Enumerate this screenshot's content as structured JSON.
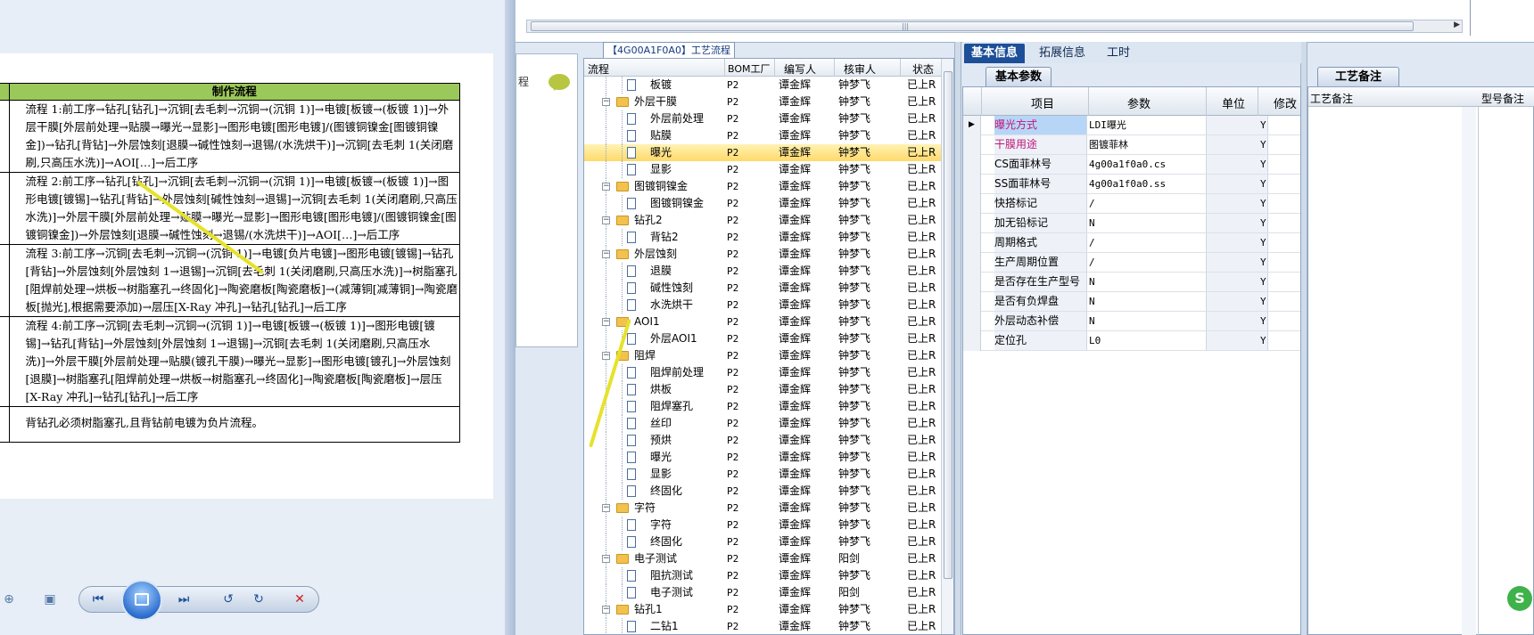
{
  "doc": {
    "table_header": "制作流程",
    "flows": [
      "流程 1:前工序→钻孔[钻孔]→沉铜[去毛刺→沉铜→(沉铜 1)]→电镀[板镀→(板镀 1)]→外层干膜[外层前处理→贴膜→曝光→显影]→图形电镀[图形电镀]/(图镀铜镍金[图镀铜镍金])→钻孔[背钻]→外层蚀刻[退膜→碱性蚀刻→退锡/(水洗烘干)]→沉铜[去毛刺 1(关闭磨刷,只高压水洗)]→AOI[…]→后工序",
      "流程 2:前工序→钻孔[钻孔]→沉铜[去毛刺→沉铜→(沉铜 1)]→电镀[板镀→(板镀 1)]→图形电镀[镀锡]→钻孔[背钻]→外层蚀刻[碱性蚀刻→退锡]→沉铜[去毛刺 1(关闭磨刷,只高压水洗)]→外层干膜[外层前处理→贴膜→曝光→显影]→图形电镀[图形电镀]/(图镀铜镍金[图镀铜镍金])→外层蚀刻[退膜→碱性蚀刻→退锡/(水洗烘干)]→AOI[…]→后工序",
      "流程 3:前工序→沉铜[去毛刺→沉铜→(沉铜 1)]→电镀[负片电镀]→图形电镀[镀锡]→钻孔[背钻]→外层蚀刻[外层蚀刻 1→退锡]→沉铜[去毛刺 1(关闭磨刷,只高压水洗)]→树脂塞孔[阻焊前处理→烘板→树脂塞孔→终固化]→陶瓷磨板[陶瓷磨板]→(减薄铜[减薄铜]→陶瓷磨板[抛光],根据需要添加)→层压[X-Ray 冲孔]→钻孔[钻孔]→后工序",
      "流程 4:前工序→沉铜[去毛刺→沉铜→(沉铜 1)]→电镀[板镀→(板镀 1)]→图形电镀[镀锡]→钻孔[背钻]→外层蚀刻[外层蚀刻 1→退锡]→沉铜[去毛刺 1(关闭磨刷,只高压水洗)]→外层干膜[外层前处理→贴膜(镀孔干膜)→曝光→显影]→图形电镀[镀孔]→外层蚀刻[退膜]→树脂塞孔[阻焊前处理→烘板→树脂塞孔→终固化]→陶瓷磨板[陶瓷磨板]→层压[X-Ray 冲孔]→钻孔[钻孔]→后工序"
    ],
    "note": "背钻孔必须树脂塞孔,且背钻前电镀为负片流程。"
  },
  "under_panel": {
    "label": "程"
  },
  "tree": {
    "tab_label": "【4G00A1F0A0】工艺流程",
    "columns": [
      "流程",
      "BOM工厂",
      "编写人",
      "核审人",
      "状态"
    ],
    "rows": [
      {
        "level": 2,
        "type": "doc",
        "name": "板镀",
        "bom": "P2",
        "writer": "谭金辉",
        "reviewer": "钟梦飞",
        "status": "已上R"
      },
      {
        "level": 1,
        "type": "folder",
        "name": "外层干膜",
        "bom": "P2",
        "writer": "谭金辉",
        "reviewer": "钟梦飞",
        "status": "已上R"
      },
      {
        "level": 2,
        "type": "doc",
        "name": "外层前处理",
        "bom": "P2",
        "writer": "谭金辉",
        "reviewer": "钟梦飞",
        "status": "已上R"
      },
      {
        "level": 2,
        "type": "doc",
        "name": "贴膜",
        "bom": "P2",
        "writer": "谭金辉",
        "reviewer": "钟梦飞",
        "status": "已上R"
      },
      {
        "level": 2,
        "type": "doc",
        "name": "曝光",
        "bom": "P2",
        "writer": "谭金辉",
        "reviewer": "钟梦飞",
        "status": "已上R",
        "selected": true
      },
      {
        "level": 2,
        "type": "doc",
        "name": "显影",
        "bom": "P2",
        "writer": "谭金辉",
        "reviewer": "钟梦飞",
        "status": "已上R"
      },
      {
        "level": 1,
        "type": "folder",
        "name": "图镀铜镍金",
        "bom": "P2",
        "writer": "谭金辉",
        "reviewer": "钟梦飞",
        "status": "已上R"
      },
      {
        "level": 2,
        "type": "doc",
        "name": "图镀铜镍金",
        "bom": "P2",
        "writer": "谭金辉",
        "reviewer": "钟梦飞",
        "status": "已上R"
      },
      {
        "level": 1,
        "type": "folder",
        "name": "钻孔2",
        "bom": "P2",
        "writer": "谭金辉",
        "reviewer": "钟梦飞",
        "status": "已上R"
      },
      {
        "level": 2,
        "type": "doc",
        "name": "背钻2",
        "bom": "P2",
        "writer": "谭金辉",
        "reviewer": "钟梦飞",
        "status": "已上R"
      },
      {
        "level": 1,
        "type": "folder",
        "name": "外层蚀刻",
        "bom": "P2",
        "writer": "谭金辉",
        "reviewer": "钟梦飞",
        "status": "已上R"
      },
      {
        "level": 2,
        "type": "doc",
        "name": "退膜",
        "bom": "P2",
        "writer": "谭金辉",
        "reviewer": "钟梦飞",
        "status": "已上R"
      },
      {
        "level": 2,
        "type": "doc",
        "name": "碱性蚀刻",
        "bom": "P2",
        "writer": "谭金辉",
        "reviewer": "钟梦飞",
        "status": "已上R"
      },
      {
        "level": 2,
        "type": "doc",
        "name": "水洗烘干",
        "bom": "P2",
        "writer": "谭金辉",
        "reviewer": "钟梦飞",
        "status": "已上R"
      },
      {
        "level": 1,
        "type": "folder",
        "name": "AOI1",
        "bom": "P2",
        "writer": "谭金辉",
        "reviewer": "钟梦飞",
        "status": "已上R"
      },
      {
        "level": 2,
        "type": "doc",
        "name": "外层AOI1",
        "bom": "P2",
        "writer": "谭金辉",
        "reviewer": "钟梦飞",
        "status": "已上R"
      },
      {
        "level": 1,
        "type": "folder",
        "name": "阻焊",
        "bom": "P2",
        "writer": "谭金辉",
        "reviewer": "钟梦飞",
        "status": "已上R"
      },
      {
        "level": 2,
        "type": "doc",
        "name": "阻焊前处理",
        "bom": "P2",
        "writer": "谭金辉",
        "reviewer": "钟梦飞",
        "status": "已上R"
      },
      {
        "level": 2,
        "type": "doc",
        "name": "烘板",
        "bom": "P2",
        "writer": "谭金辉",
        "reviewer": "钟梦飞",
        "status": "已上R"
      },
      {
        "level": 2,
        "type": "doc",
        "name": "阻焊塞孔",
        "bom": "P2",
        "writer": "谭金辉",
        "reviewer": "钟梦飞",
        "status": "已上R"
      },
      {
        "level": 2,
        "type": "doc",
        "name": "丝印",
        "bom": "P2",
        "writer": "谭金辉",
        "reviewer": "钟梦飞",
        "status": "已上R"
      },
      {
        "level": 2,
        "type": "doc",
        "name": "预烘",
        "bom": "P2",
        "writer": "谭金辉",
        "reviewer": "钟梦飞",
        "status": "已上R"
      },
      {
        "level": 2,
        "type": "doc",
        "name": "曝光",
        "bom": "P2",
        "writer": "谭金辉",
        "reviewer": "钟梦飞",
        "status": "已上R"
      },
      {
        "level": 2,
        "type": "doc",
        "name": "显影",
        "bom": "P2",
        "writer": "谭金辉",
        "reviewer": "钟梦飞",
        "status": "已上R"
      },
      {
        "level": 2,
        "type": "doc",
        "name": "终固化",
        "bom": "P2",
        "writer": "谭金辉",
        "reviewer": "钟梦飞",
        "status": "已上R"
      },
      {
        "level": 1,
        "type": "folder",
        "name": "字符",
        "bom": "P2",
        "writer": "谭金辉",
        "reviewer": "钟梦飞",
        "status": "已上R"
      },
      {
        "level": 2,
        "type": "doc",
        "name": "字符",
        "bom": "P2",
        "writer": "谭金辉",
        "reviewer": "钟梦飞",
        "status": "已上R"
      },
      {
        "level": 2,
        "type": "doc",
        "name": "终固化",
        "bom": "P2",
        "writer": "谭金辉",
        "reviewer": "钟梦飞",
        "status": "已上R"
      },
      {
        "level": 1,
        "type": "folder",
        "name": "电子测试",
        "bom": "P2",
        "writer": "谭金辉",
        "reviewer": "阳剑",
        "status": "已上R"
      },
      {
        "level": 2,
        "type": "doc",
        "name": "阻抗测试",
        "bom": "P2",
        "writer": "谭金辉",
        "reviewer": "钟梦飞",
        "status": "已上R"
      },
      {
        "level": 2,
        "type": "doc",
        "name": "电子测试",
        "bom": "P2",
        "writer": "谭金辉",
        "reviewer": "阳剑",
        "status": "已上R"
      },
      {
        "level": 1,
        "type": "folder",
        "name": "钻孔1",
        "bom": "P2",
        "writer": "谭金辉",
        "reviewer": "钟梦飞",
        "status": "已上R"
      },
      {
        "level": 2,
        "type": "doc",
        "name": "二钻1",
        "bom": "P2",
        "writer": "谭金辉",
        "reviewer": "钟梦飞",
        "status": "已上R"
      }
    ]
  },
  "props": {
    "tabs": [
      "基本信息",
      "拓展信息",
      "工时"
    ],
    "sub_tab": "基本参数",
    "columns": [
      "项目",
      "参数",
      "单位",
      "修改"
    ],
    "rows": [
      {
        "key": "曝光方式",
        "value": "LDI曝光",
        "mod": "Y",
        "pink": true,
        "current": true
      },
      {
        "key": "干膜用途",
        "value": "图镀菲林",
        "mod": "Y",
        "pink": true
      },
      {
        "key": "CS面菲林号",
        "value": "4g00a1f0a0.cs",
        "mod": "Y"
      },
      {
        "key": "SS面菲林号",
        "value": "4g00a1f0a0.ss",
        "mod": "Y"
      },
      {
        "key": "快搭标记",
        "value": "/",
        "mod": "Y"
      },
      {
        "key": "加无铅标记",
        "value": "N",
        "mod": "Y"
      },
      {
        "key": "周期格式",
        "value": "/",
        "mod": "Y"
      },
      {
        "key": "生产周期位置",
        "value": "/",
        "mod": "Y"
      },
      {
        "key": "是否存在生产型号",
        "value": "N",
        "mod": "Y"
      },
      {
        "key": "是否有负焊盘",
        "value": "N",
        "mod": "Y"
      },
      {
        "key": "外层动态补偿",
        "value": "N",
        "mod": "Y"
      },
      {
        "key": "定位孔",
        "value": "L0",
        "mod": "Y"
      }
    ]
  },
  "notes": {
    "tab": "工艺备注",
    "columns": [
      "工艺备注",
      "型号备注"
    ]
  },
  "tray": {
    "ime_icon": "S"
  },
  "colors": {
    "accent": "#1d4f98",
    "table_header": "#9bc85a",
    "selected_row": "#ffd96b",
    "pink_key": "#c0177a"
  }
}
